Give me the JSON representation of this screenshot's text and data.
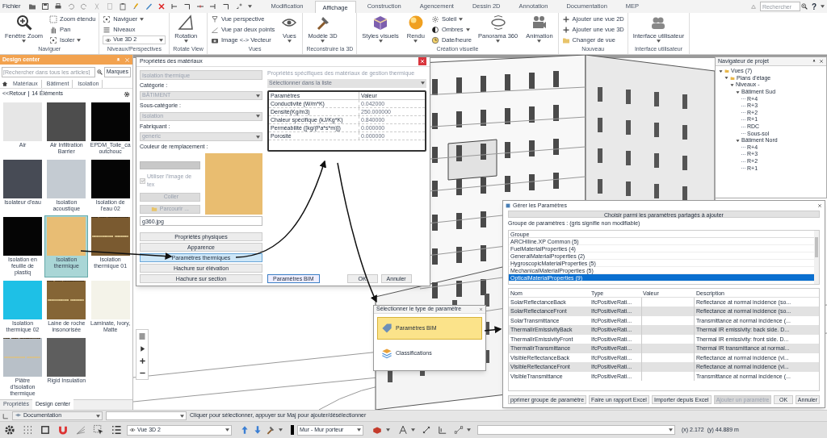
{
  "menu_bar": {
    "file": "Fichier",
    "tabs": [
      {
        "label": "Modification",
        "selected": false
      },
      {
        "label": "Affichage",
        "selected": true
      },
      {
        "label": "Construction",
        "selected": false
      },
      {
        "label": "Agencement",
        "selected": false
      },
      {
        "label": "Dessin 2D",
        "selected": false
      },
      {
        "label": "Annotation",
        "selected": false
      },
      {
        "label": "Documentation",
        "selected": false
      },
      {
        "label": "MEP",
        "selected": false
      }
    ],
    "search": {
      "placeholder": "Rechercher"
    },
    "help": "?"
  },
  "ribbon": {
    "groups": [
      {
        "label": "Naviguer",
        "columns": [
          [
            {
              "kind": "large",
              "label": "Fenêtre Zoom",
              "dropdown": true
            }
          ],
          [
            {
              "kind": "small",
              "label": "Zoom étendu",
              "dropdown": false
            },
            {
              "kind": "small",
              "label": "Pan",
              "dropdown": false
            },
            {
              "kind": "small",
              "label": "Isoler",
              "dropdown": true
            }
          ]
        ]
      },
      {
        "label": "Niveaux/Perspectives",
        "columns": [
          [
            {
              "kind": "small",
              "label": "Naviguer",
              "dropdown": true
            },
            {
              "kind": "small",
              "label": "Niveaux",
              "dropdown": false
            },
            {
              "kind": "select",
              "label": "Vue 3D 2",
              "dropdown": true
            }
          ]
        ]
      },
      {
        "label": "Rotate View",
        "columns": [
          [
            {
              "kind": "large",
              "label": "Rotation",
              "dropdown": true
            }
          ]
        ]
      },
      {
        "label": "Vues",
        "columns": [
          [
            {
              "kind": "small",
              "label": "Vue perspective",
              "dropdown": false
            },
            {
              "kind": "small",
              "label": "Vue par deux points",
              "dropdown": false
            },
            {
              "kind": "small",
              "label": "Image <-> Vecteur",
              "dropdown": false
            }
          ],
          [
            {
              "kind": "large",
              "label": "Vues",
              "dropdown": true
            }
          ]
        ]
      },
      {
        "label": "Reconstruire la 3D",
        "columns": [
          [
            {
              "kind": "large",
              "label": "Modèle 3D",
              "dropdown": true
            }
          ]
        ]
      },
      {
        "label": "Création visuelle",
        "columns": [
          [
            {
              "kind": "large",
              "label": "Styles visuels",
              "dropdown": true
            }
          ],
          [
            {
              "kind": "large",
              "label": "Rendu",
              "dropdown": true
            }
          ],
          [
            {
              "kind": "small",
              "label": "Soleil",
              "dropdown": true
            },
            {
              "kind": "small",
              "label": "Ombres",
              "dropdown": true
            },
            {
              "kind": "small",
              "label": "Date/heure",
              "dropdown": false
            }
          ],
          [
            {
              "kind": "large",
              "label": "Panorama 360",
              "dropdown": true
            }
          ],
          [
            {
              "kind": "large",
              "label": "Animation",
              "dropdown": true
            }
          ]
        ]
      },
      {
        "label": "Nouveau",
        "columns": [
          [
            {
              "kind": "small",
              "label": "Ajouter une vue 2D",
              "dropdown": false
            },
            {
              "kind": "small",
              "label": "Ajouter une vue 3D",
              "dropdown": false
            },
            {
              "kind": "small",
              "label": "Changer de vue",
              "dropdown": false
            }
          ]
        ]
      },
      {
        "label": "Interface utilisateur",
        "columns": [
          [
            {
              "kind": "large",
              "label": "Interface utilisateur",
              "dropdown": true
            }
          ]
        ]
      }
    ]
  },
  "design_center": {
    "title": "Design center",
    "search": {
      "placeholder": "[Rechercher dans tous les articles]"
    },
    "brands_button": "Marques",
    "breadcrumb": [
      "Matériaux",
      "Bâtiment",
      "Isolation"
    ],
    "back": "<<Retour",
    "count": "14 Éléments",
    "materials": [
      {
        "name": "Air",
        "kind": "swatch",
        "color": "#e6e6e6",
        "selected": false
      },
      {
        "name": "Air Infiltration Barrier",
        "kind": "swatch",
        "color": "#4d4d4d",
        "selected": false
      },
      {
        "name": "EPDM_Toile_caoutchouc",
        "kind": "swatch",
        "color": "#050505",
        "selected": false
      },
      {
        "name": "Isolateur d'eau",
        "kind": "swatch",
        "color": "#474b55",
        "selected": false
      },
      {
        "name": "Isolation acoustique",
        "kind": "swatch",
        "color": "#c4cbd2",
        "selected": false
      },
      {
        "name": "Isolation de l'eau 02",
        "kind": "swatch",
        "color": "#050505",
        "selected": false
      },
      {
        "name": "Isolation en feuille de plastiq",
        "kind": "swatch",
        "color": "#050505",
        "selected": false
      },
      {
        "name": "Isolation thermique",
        "kind": "swatch",
        "color": "#e8bd74",
        "selected": true
      },
      {
        "name": "Isolation thermique 01",
        "kind": "texture",
        "color": "#7a5a30",
        "selected": false
      },
      {
        "name": "Isolation thermique 02",
        "kind": "swatch",
        "color": "#1ec0e6",
        "selected": false
      },
      {
        "name": "Laine de roche insonorisée",
        "kind": "texture",
        "color": "#856536",
        "selected": false
      },
      {
        "name": "Laminate, Ivory, Matte",
        "kind": "swatch",
        "color": "#f4f3e9",
        "selected": false
      },
      {
        "name": "Plâtre d'isolation thermique",
        "kind": "texture",
        "color": "#b8c0c8",
        "selected": false
      },
      {
        "name": "Rigid Insulation",
        "kind": "swatch",
        "color": "#5e5e5e",
        "selected": false
      }
    ],
    "tabs": [
      {
        "label": "Propriétés",
        "selected": false
      },
      {
        "label": "Design center",
        "selected": true
      }
    ]
  },
  "materials_dialog": {
    "title": "Propriétés des matériaux",
    "name_field": {
      "value": "Isolation thermique",
      "disabled": true
    },
    "selects": [
      {
        "label": "Catégorie :",
        "value": "BÂTIMENT",
        "disabled": true
      },
      {
        "label": "Sous-catégorie :",
        "value": "Isolation",
        "disabled": true
      },
      {
        "label": "Fabriquant :",
        "value": "generic",
        "disabled": true
      }
    ],
    "replacement_color": "Couleur de remplacement :",
    "texture_checkbox": {
      "label": "Utiliser l'image de tex",
      "checked": true,
      "disabled": true
    },
    "texture_buttons": [
      {
        "label": "Coller",
        "disabled": true
      },
      {
        "label": "Parcourir ...",
        "disabled": true
      }
    ],
    "texture_file": "g360.jpg",
    "sections": [
      {
        "label": "Propriétés physiques",
        "selected": false
      },
      {
        "label": "Apparence",
        "selected": false
      },
      {
        "label": "Paramètres thermiques",
        "selected": true
      },
      {
        "label": "Hachure sur élévation",
        "selected": false
      },
      {
        "label": "Hachure sur section",
        "selected": false
      }
    ],
    "panel_title": "Propriétés spécifiques des matériaux de gestion thermique",
    "list_select": "Sélectionner dans la liste",
    "table": {
      "columns": [
        "Paramètres",
        "Valeur"
      ],
      "rows": [
        [
          "Conductivité (W/m*K)",
          "0.042000"
        ],
        [
          "Densité(Kg/m3)",
          "250.000000"
        ],
        [
          "Chaleur spécifique (kJ/Kg*K)",
          "0.840000"
        ],
        [
          "Perméabilité ([kg/(Pa*s*m)])",
          "0.000000"
        ],
        [
          "Porosité",
          "0.000000"
        ]
      ]
    },
    "buttons": [
      "Paramètres BIM",
      "OK",
      "Annuler"
    ]
  },
  "type_dialog": {
    "title": "Sélectionner le type de paramètre",
    "options": [
      {
        "label": "Paramètres BIM",
        "selected": true
      },
      {
        "label": "Classifications",
        "selected": false
      }
    ]
  },
  "parameters_dialog": {
    "title": "Gérer les Paramètres",
    "shared_button": "Choisir parmi les paramètres partagés à ajouter",
    "groups_label": "Groupe de paramètres : (gris signifie non modifiable)",
    "groups_header": "Groupe",
    "groups": [
      {
        "label": "ARCHIline.XP Common (5)",
        "selected": false
      },
      {
        "label": "FuelMaterialProperties (4)",
        "selected": false
      },
      {
        "label": "GeneralMaterialProperties (2)",
        "selected": false
      },
      {
        "label": "HygroscopicMaterialProperties (5)",
        "selected": false
      },
      {
        "label": "MechanicalMaterialProperties (5)",
        "selected": false
      },
      {
        "label": "OpticalMaterialProperties (9)",
        "selected": true
      }
    ],
    "table": {
      "columns": [
        "Nom",
        "Type",
        "Valeur",
        "Description"
      ],
      "rows": [
        [
          "SolarReflectanceBack",
          "IfcPositiveRati...",
          "",
          "Reflectance at normal incidence (so..."
        ],
        [
          "SolarReflectanceFront",
          "IfcPositiveRati...",
          "",
          "Reflectance at normal incidence (so..."
        ],
        [
          "SolarTransmittance",
          "IfcPositiveRati...",
          "",
          "Transmittance at normal incidence (..."
        ],
        [
          "ThermalIrEmissivityBack",
          "IfcPositiveRati...",
          "",
          "Thermal IR emissivity: back side. D..."
        ],
        [
          "ThermalIrEmissivityFront",
          "IfcPositiveRati...",
          "",
          "Thermal IR emissivity: front side. D..."
        ],
        [
          "ThermalIrTransmittance",
          "IfcPositiveRati...",
          "",
          "Thermal IR transmittance at normal..."
        ],
        [
          "VisibleReflectanceBack",
          "IfcPositiveRati...",
          "",
          "Reflectance at normal incidence (vi..."
        ],
        [
          "VisibleReflectanceFront",
          "IfcPositiveRati...",
          "",
          "Reflectance at normal incidence (vi..."
        ],
        [
          "VisibleTransmittance",
          "IfcPositiveRati...",
          "",
          "Transmittance at normal incidence (..."
        ]
      ]
    },
    "buttons": [
      {
        "label": "pprimer groupe de paramètre",
        "disabled": false
      },
      {
        "label": "Faire un rapport Excel",
        "disabled": false
      },
      {
        "label": "Importer depuis Excel",
        "disabled": false
      },
      {
        "label": "Ajouter un paramètre",
        "disabled": true
      },
      {
        "label": "OK",
        "disabled": false
      },
      {
        "label": "Annuler",
        "disabled": false
      }
    ]
  },
  "navigator": {
    "title": "Navigateur de projet",
    "tree": [
      {
        "label": "Vues (7)",
        "children": [
          {
            "label": "Plans d'étage",
            "children": [
              {
                "label": "Niveaux -",
                "children": [
                  {
                    "label": "Bâtiment Sud",
                    "children": [
                      {
                        "label": "R+4"
                      },
                      {
                        "label": "R+3"
                      },
                      {
                        "label": "R+2"
                      },
                      {
                        "label": "R+1"
                      },
                      {
                        "label": "RDC"
                      },
                      {
                        "label": "Sous-sol"
                      }
                    ]
                  },
                  {
                    "label": "Bâtiment Nord",
                    "children": [
                      {
                        "label": "R+4"
                      },
                      {
                        "label": "R+3"
                      },
                      {
                        "label": "R+2"
                      },
                      {
                        "label": "R+1"
                      }
                    ]
                  }
                ]
              }
            ]
          }
        ]
      }
    ]
  },
  "command_bar": {
    "layer": "Documentation",
    "hint": "Cliquer pour sélectionner, appuyer sur Maj pour ajouter/désélectionner"
  },
  "status_bar": {
    "view": "Vue 3D 2",
    "wall_type": "Mur - Mur porteur",
    "x": "(x) 2.172",
    "y": "(y) 44.889 m"
  }
}
